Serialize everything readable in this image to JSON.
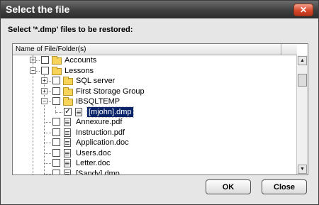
{
  "window": {
    "title": "Select the file",
    "close_glyph": "✕"
  },
  "prompt": "Select '*.dmp' files to be restored:",
  "tree": {
    "column_header": "Name of File/Folder(s)",
    "items": [
      {
        "label": "Accounts",
        "type": "folder",
        "expander": "+",
        "checked": false,
        "selected": false
      },
      {
        "label": "Lessons",
        "type": "folder",
        "expander": "−",
        "checked": false,
        "selected": false
      },
      {
        "label": "SQL server",
        "type": "folder",
        "expander": "+",
        "checked": false,
        "selected": false
      },
      {
        "label": "First Storage Group",
        "type": "folder",
        "expander": "+",
        "checked": false,
        "selected": false
      },
      {
        "label": "IBSQLTEMP",
        "type": "folder",
        "expander": "−",
        "checked": false,
        "selected": false
      },
      {
        "label": "[mjohn].dmp",
        "type": "file",
        "expander": "",
        "checked": true,
        "selected": true
      },
      {
        "label": "Annexure.pdf",
        "type": "file",
        "expander": "",
        "checked": false,
        "selected": false
      },
      {
        "label": "Instruction.pdf",
        "type": "file",
        "expander": "",
        "checked": false,
        "selected": false
      },
      {
        "label": "Application.doc",
        "type": "file",
        "expander": "",
        "checked": false,
        "selected": false
      },
      {
        "label": "Users.doc",
        "type": "file",
        "expander": "",
        "checked": false,
        "selected": false
      },
      {
        "label": "Letter.doc",
        "type": "file",
        "expander": "",
        "checked": false,
        "selected": false
      },
      {
        "label": "[Sandy].dmp",
        "type": "file",
        "expander": "",
        "checked": false,
        "selected": false
      }
    ]
  },
  "scrollbar": {
    "up_glyph": "▲",
    "down_glyph": "▼"
  },
  "buttons": {
    "ok": "OK",
    "close": "Close"
  },
  "colors": {
    "selection": "#0a246a",
    "titlebar": "#3e3e3e",
    "folder": "#f7d35a"
  },
  "icons": {
    "folder": "folder-icon",
    "file": "file-icon",
    "checkmark": "✓"
  }
}
